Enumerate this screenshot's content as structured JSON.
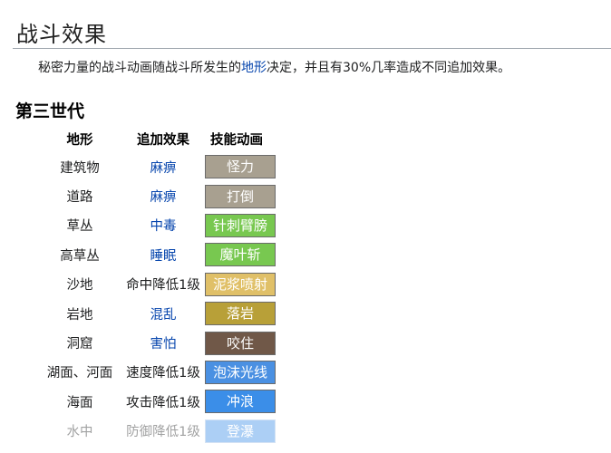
{
  "page": {
    "title": "战斗效果",
    "intro_before": "秘密力量的战斗动画随战斗所发生的",
    "intro_link": "地形",
    "intro_after": "决定，并且有30%几率造成不同追加效果。"
  },
  "section": {
    "heading": "第三世代"
  },
  "table": {
    "headers": [
      "地形",
      "追加效果",
      "技能动画"
    ],
    "rows": [
      {
        "terrain": "建筑物",
        "effect": "麻痹",
        "effect_is_link": true,
        "move": "怪力",
        "color": "#a8a090"
      },
      {
        "terrain": "道路",
        "effect": "麻痹",
        "effect_is_link": true,
        "move": "打倒",
        "color": "#a8a090"
      },
      {
        "terrain": "草丛",
        "effect": "中毒",
        "effect_is_link": true,
        "move": "针刺臂膀",
        "color": "#78c850"
      },
      {
        "terrain": "高草丛",
        "effect": "睡眠",
        "effect_is_link": true,
        "move": "魔叶斩",
        "color": "#78c850"
      },
      {
        "terrain": "沙地",
        "effect": "命中降低1级",
        "effect_is_link": false,
        "move": "泥浆喷射",
        "color": "#e0c068"
      },
      {
        "terrain": "岩地",
        "effect": "混乱",
        "effect_is_link": true,
        "move": "落岩",
        "color": "#b8a038"
      },
      {
        "terrain": "洞窟",
        "effect": "害怕",
        "effect_is_link": true,
        "move": "咬住",
        "color": "#705848"
      },
      {
        "terrain": "湖面、河面",
        "effect": "速度降低1级",
        "effect_is_link": false,
        "move": "泡沫光线",
        "color": "#4a90e2"
      },
      {
        "terrain": "海面",
        "effect": "攻击降低1级",
        "effect_is_link": false,
        "move": "冲浪",
        "color": "#3b8ee8"
      },
      {
        "terrain": "水中",
        "effect": "防御降低1级",
        "effect_is_link": false,
        "move": "登瀑",
        "color": "#3b8ee8",
        "faded": true
      }
    ]
  }
}
